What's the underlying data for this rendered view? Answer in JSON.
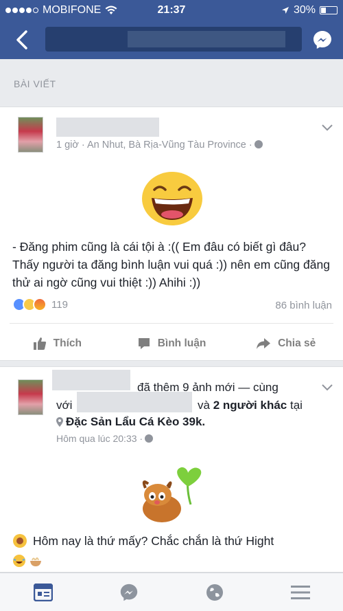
{
  "status_bar": {
    "carrier": "MOBIFONE",
    "time": "21:37",
    "battery": "30%",
    "battery_level": 0.3
  },
  "section": {
    "label": "BÀI VIẾT"
  },
  "post1": {
    "meta": "1 giờ · An Nhut, Bà Rịa-Vũng Tàu Province ·",
    "text": "- Đăng phim cũng là cái tội à :((  Em đâu có biết gì đâu? Thấy người ta đăng bình luận vui quá :)) nên em cũng đăng thử ai ngờ cũng vui thiệt :)) Ahihi :))",
    "reaction_count": "119",
    "comment_count": "86 bình luận"
  },
  "actions": {
    "like": "Thích",
    "comment": "Bình luận",
    "share": "Chia sẻ"
  },
  "post2": {
    "header_part1": "đã thêm 9 ảnh mới — cùng",
    "header_with": "với",
    "header_and": "và",
    "others": "2 người khác",
    "at": "tại",
    "place": "Đặc Sản Lẩu Cá Kèo 39k.",
    "meta": "Hôm qua lúc 20:33 ·",
    "text": "Hôm nay là thứ mấy? Chắc chắn là thứ Hight"
  },
  "colors": {
    "brand": "#3b5998",
    "like": "#5890ff"
  }
}
